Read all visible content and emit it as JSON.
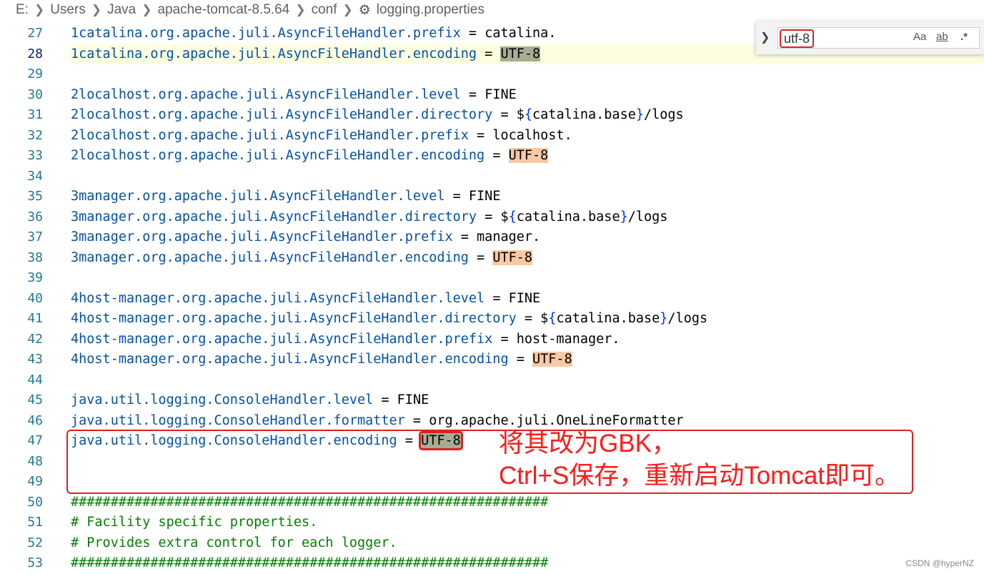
{
  "breadcrumb": [
    "E:",
    "Users",
    "Java",
    "apache-tomcat-8.5.64",
    "conf",
    "logging.properties"
  ],
  "find": {
    "query": "utf-8",
    "options": [
      "Aa",
      "ab",
      ".*"
    ]
  },
  "lines": [
    {
      "n": "27",
      "key": "1catalina.org.apache.juli.AsyncFileHandler.prefix",
      "op": " = ",
      "val": "catalina."
    },
    {
      "n": "28",
      "key": "1catalina.org.apache.juli.AsyncFileHandler.encoding",
      "op": " = ",
      "val": "UTF-8",
      "hl": "cur"
    },
    {
      "n": "29"
    },
    {
      "n": "30",
      "key": "2localhost.org.apache.juli.AsyncFileHandler.level",
      "op": " = ",
      "val": "FINE"
    },
    {
      "n": "31",
      "key": "2localhost.org.apache.juli.AsyncFileHandler.directory",
      "op": " = ",
      "val": "${catalina.base}/logs"
    },
    {
      "n": "32",
      "key": "2localhost.org.apache.juli.AsyncFileHandler.prefix",
      "op": " = ",
      "val": "localhost."
    },
    {
      "n": "33",
      "key": "2localhost.org.apache.juli.AsyncFileHandler.encoding",
      "op": " = ",
      "val": "UTF-8",
      "hl": "match"
    },
    {
      "n": "34"
    },
    {
      "n": "35",
      "key": "3manager.org.apache.juli.AsyncFileHandler.level",
      "op": " = ",
      "val": "FINE"
    },
    {
      "n": "36",
      "key": "3manager.org.apache.juli.AsyncFileHandler.directory",
      "op": " = ",
      "val": "${catalina.base}/logs"
    },
    {
      "n": "37",
      "key": "3manager.org.apache.juli.AsyncFileHandler.prefix",
      "op": " = ",
      "val": "manager."
    },
    {
      "n": "38",
      "key": "3manager.org.apache.juli.AsyncFileHandler.encoding",
      "op": " = ",
      "val": "UTF-8",
      "hl": "match"
    },
    {
      "n": "39"
    },
    {
      "n": "40",
      "key": "4host-manager.org.apache.juli.AsyncFileHandler.level",
      "op": " = ",
      "val": "FINE"
    },
    {
      "n": "41",
      "key": "4host-manager.org.apache.juli.AsyncFileHandler.directory",
      "op": " = ",
      "val": "${catalina.base}/logs"
    },
    {
      "n": "42",
      "key": "4host-manager.org.apache.juli.AsyncFileHandler.prefix",
      "op": " = ",
      "val": "host-manager."
    },
    {
      "n": "43",
      "key": "4host-manager.org.apache.juli.AsyncFileHandler.encoding",
      "op": " = ",
      "val": "UTF-8",
      "hl": "match"
    },
    {
      "n": "44"
    },
    {
      "n": "45",
      "key": "java.util.logging.ConsoleHandler.level",
      "op": " = ",
      "val": "FINE"
    },
    {
      "n": "46",
      "key": "java.util.logging.ConsoleHandler.formatter",
      "op": " = ",
      "val": "org.apache.juli.OneLineFormatter"
    },
    {
      "n": "47",
      "key": "java.util.logging.ConsoleHandler.encoding",
      "op": " = ",
      "val": "UTF-8",
      "hl": "boxed"
    },
    {
      "n": "48"
    },
    {
      "n": "49"
    },
    {
      "n": "50",
      "comment": "############################################################"
    },
    {
      "n": "51",
      "comment": "# Facility specific properties."
    },
    {
      "n": "52",
      "comment": "# Provides extra control for each logger."
    },
    {
      "n": "53",
      "comment": "############################################################"
    }
  ],
  "annotation": {
    "line1": "将其改为GBK，",
    "line2": "Ctrl+S保存，重新启动Tomcat即可。"
  },
  "watermark": "CSDN @hyperNZ",
  "colors": {
    "key": "#0451a5",
    "comment": "#008000",
    "match": "#f8c9a6",
    "current_match": "#a8ac94",
    "annotation": "#ff1a1a"
  }
}
